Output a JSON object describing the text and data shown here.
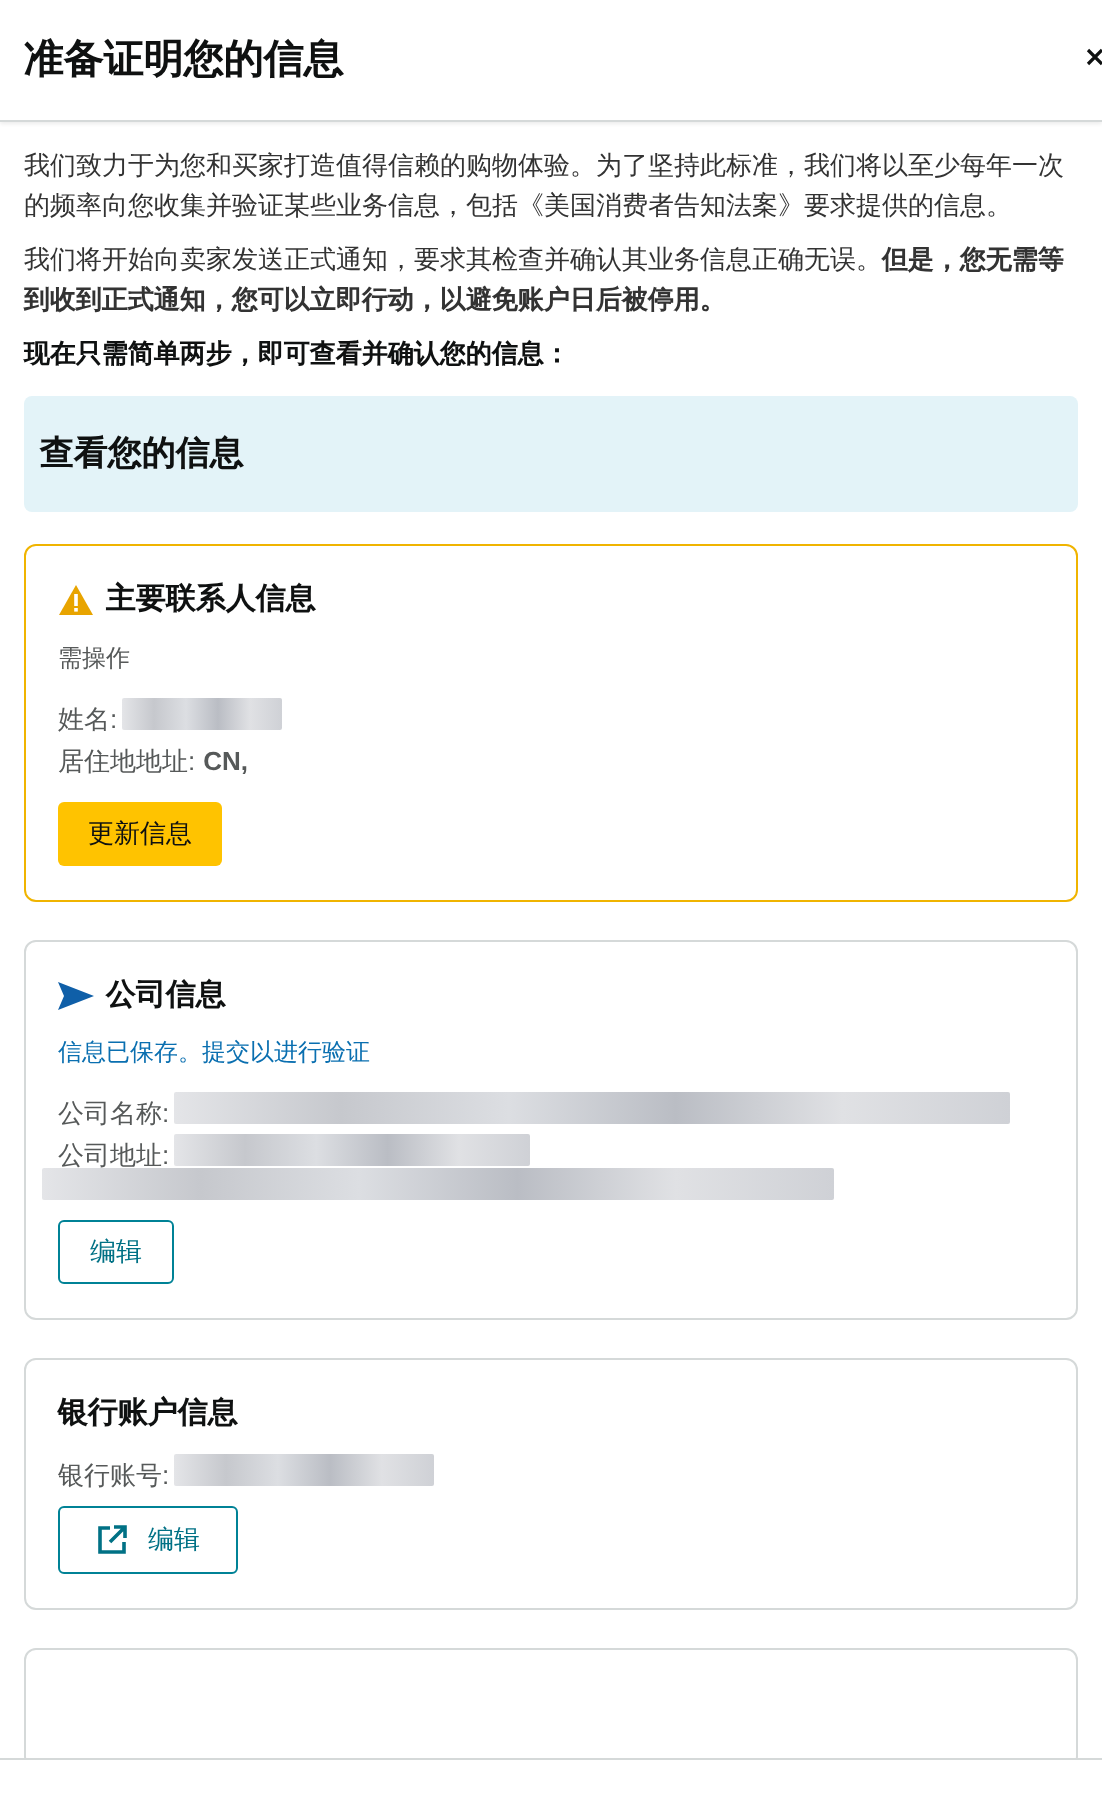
{
  "header": {
    "title": "准备证明您的信息"
  },
  "paragraphs": [
    "我们致力于为您和买家打造值得信赖的购物体验。为了坚持此标准，我们将以至少每年一次的频率向您收集并验证某些业务信息，包括《美国消费者告知法案》要求提供的信息。",
    "我们将开始向卖家发送正式通知，要求其检查并确认其业务信息正确无误。**但是，您无需等到收到正式通知，您可以立即行动，以避免账户日后被停用。**"
  ],
  "steps_intro": "现在只需简单两步，即可查看并确认您的信息：",
  "section_title": "查看您的信息",
  "cards": [
    {
      "kind": "warning",
      "title": "主要联系人信息",
      "status": "需操作",
      "fields": [
        {
          "label": "姓名:",
          "kind": "redacted_short"
        },
        {
          "label": "居住地地址:",
          "kind": "text",
          "value": "CN,"
        }
      ],
      "button": {
        "kind": "primary",
        "label": "更新信息"
      }
    },
    {
      "kind": "saved",
      "title": "公司信息",
      "status": "信息已保存。提交以进行验证",
      "fields": [
        {
          "label": "公司名称:",
          "kind": "redacted_long"
        },
        {
          "label": "公司地址:",
          "kind": "redacted_wrapped"
        }
      ],
      "button": {
        "kind": "secondary",
        "label": "编辑"
      }
    },
    {
      "kind": "plain",
      "title": "银行账户信息",
      "fields": [
        {
          "label": "银行账号:",
          "kind": "redacted_medium"
        }
      ],
      "button": {
        "kind": "external",
        "label": "编辑"
      }
    }
  ],
  "more_below": true
}
